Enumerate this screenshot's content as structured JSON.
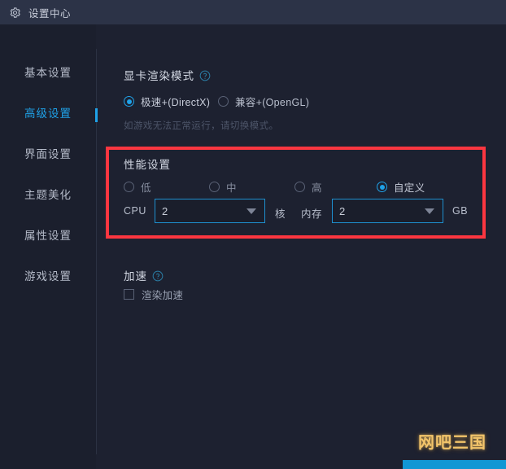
{
  "window": {
    "title": "设置中心",
    "gear_icon": "gear-icon"
  },
  "sidebar": {
    "items": [
      {
        "label": "基本设置",
        "active": false
      },
      {
        "label": "高级设置",
        "active": true
      },
      {
        "label": "界面设置",
        "active": false
      },
      {
        "label": "主题美化",
        "active": false
      },
      {
        "label": "属性设置",
        "active": false
      },
      {
        "label": "游戏设置",
        "active": false
      }
    ]
  },
  "render_mode": {
    "title": "显卡渲染模式",
    "help_icon": "help-circle-icon",
    "options": [
      {
        "label": "极速+(DirectX)",
        "selected": true
      },
      {
        "label": "兼容+(OpenGL)",
        "selected": false
      }
    ],
    "hint": "如游戏无法正常运行，请切换模式。"
  },
  "performance": {
    "title": "性能设置",
    "highlighted": true,
    "highlight_color": "#fb3640",
    "options": [
      {
        "label": "低",
        "selected": false
      },
      {
        "label": "中",
        "selected": false
      },
      {
        "label": "高",
        "selected": false
      },
      {
        "label": "自定义",
        "selected": true
      }
    ],
    "cpu": {
      "label": "CPU",
      "value": "2",
      "unit": "核",
      "arrow_icon": "chevron-down-icon"
    },
    "memory": {
      "label": "内存",
      "value": "2",
      "unit": "GB",
      "arrow_icon": "chevron-down-icon"
    }
  },
  "acceleration": {
    "title": "加速",
    "help_icon": "help-circle-icon",
    "checkbox": {
      "label": "渲染加速",
      "checked": false
    }
  },
  "watermark": {
    "text": "网吧三国"
  },
  "colors": {
    "accent": "#1fa2e8",
    "titlebar": "#2c3347",
    "background": "#1d2130",
    "sidebar": "#1b1f2d",
    "highlight": "#fb3640",
    "watermark": "#f2c46a",
    "bottom_bar": "#1297d4"
  }
}
